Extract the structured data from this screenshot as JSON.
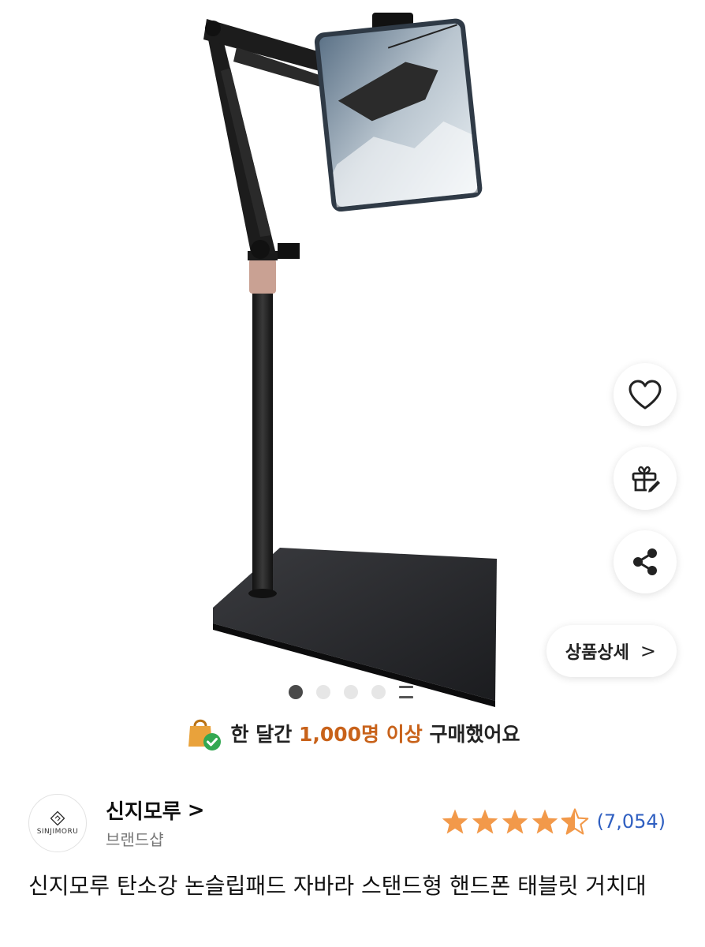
{
  "product_image": {
    "alt": "product-photo"
  },
  "actions": {
    "wishlist_icon": "heart-icon",
    "gift_icon": "gift-icon",
    "share_icon": "share-icon",
    "detail_label": "상품상세",
    "detail_chevron": ">"
  },
  "carousel": {
    "total_dots": 4,
    "active_index": 0
  },
  "social_proof": {
    "prefix": "한 달간 ",
    "highlight": "1,000명 이상",
    "suffix": " 구매했어요",
    "highlight_color": "#c8621a"
  },
  "brand": {
    "logo_text": "SINJIMORU",
    "name": "신지모루",
    "chevron": ">",
    "type": "브랜드샵"
  },
  "rating": {
    "stars": 4.5,
    "count_text": "(7,054)",
    "star_color": "#f2994a"
  },
  "product": {
    "title": "신지모루 탄소강 논슬립패드 자바라 스탠드형 핸드폰 태블릿 거치대"
  }
}
